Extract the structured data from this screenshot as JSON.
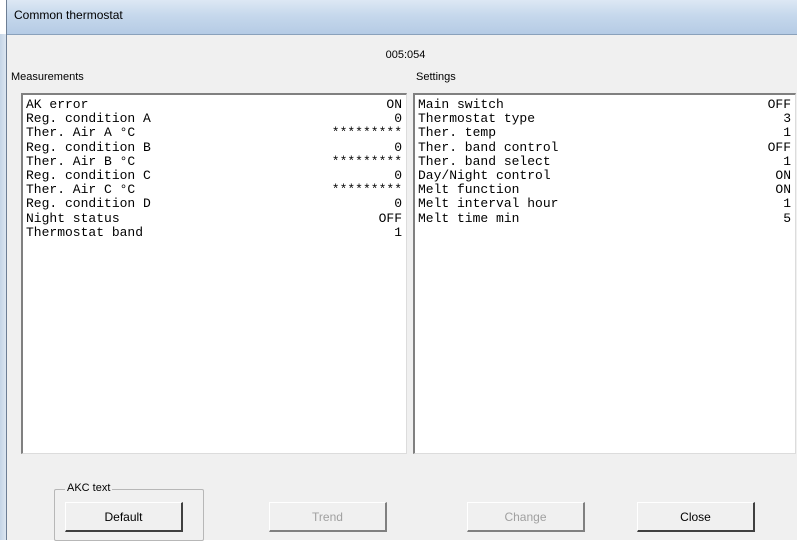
{
  "window": {
    "title": "Common thermostat"
  },
  "address": "005:054",
  "measurements": {
    "label": "Measurements",
    "rows": [
      {
        "name": "AK error",
        "value": "ON"
      },
      {
        "name": "Reg. condition A",
        "value": "0"
      },
      {
        "name": "Ther. Air A °C",
        "value": "*********"
      },
      {
        "name": "Reg. condition B",
        "value": "0"
      },
      {
        "name": "Ther. Air B °C",
        "value": "*********"
      },
      {
        "name": "Reg. condition C",
        "value": "0"
      },
      {
        "name": "Ther. Air C °C",
        "value": "*********"
      },
      {
        "name": "Reg. condition D",
        "value": "0"
      },
      {
        "name": "Night status",
        "value": "OFF"
      },
      {
        "name": "Thermostat band",
        "value": "1"
      }
    ]
  },
  "settings": {
    "label": "Settings",
    "rows": [
      {
        "name": "Main switch",
        "value": "OFF"
      },
      {
        "name": "Thermostat type",
        "value": "3"
      },
      {
        "name": "Ther. temp",
        "value": "1"
      },
      {
        "name": "Ther. band control",
        "value": "OFF"
      },
      {
        "name": "Ther. band select",
        "value": "1"
      },
      {
        "name": "Day/Night control",
        "value": "ON"
      },
      {
        "name": "Melt function",
        "value": "ON"
      },
      {
        "name": "Melt interval hour",
        "value": "1"
      },
      {
        "name": "Melt time min",
        "value": "5"
      }
    ]
  },
  "akc_text": {
    "legend": "AKC text",
    "default_label": "Default"
  },
  "buttons": {
    "trend_label": "Trend",
    "change_label": "Change",
    "close_label": "Close"
  }
}
